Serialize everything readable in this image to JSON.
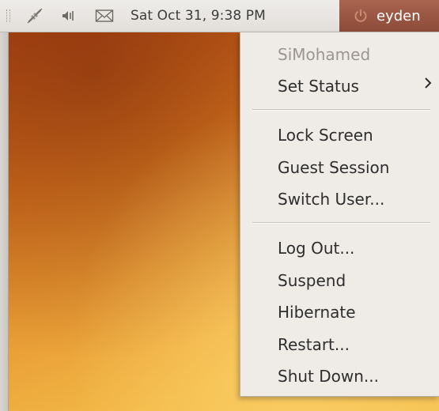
{
  "panel": {
    "clock": "Sat Oct 31,  9:38 PM",
    "user_name": "eyden",
    "icons": [
      "network-icon",
      "volume-icon",
      "mail-icon",
      "power-icon"
    ]
  },
  "menu": {
    "header": "SiMohamed",
    "set_status": "Set Status",
    "lock_screen": "Lock Screen",
    "guest_session": "Guest Session",
    "switch_user": "Switch User...",
    "log_out": "Log Out...",
    "suspend": "Suspend",
    "hibernate": "Hibernate",
    "restart": "Restart...",
    "shut_down": "Shut Down..."
  },
  "colors": {
    "panel_bg": "#e6e3df",
    "user_button_bg": "#9a5642",
    "menu_bg": "#efece8",
    "wallpaper_accent": "#e08a2c"
  }
}
